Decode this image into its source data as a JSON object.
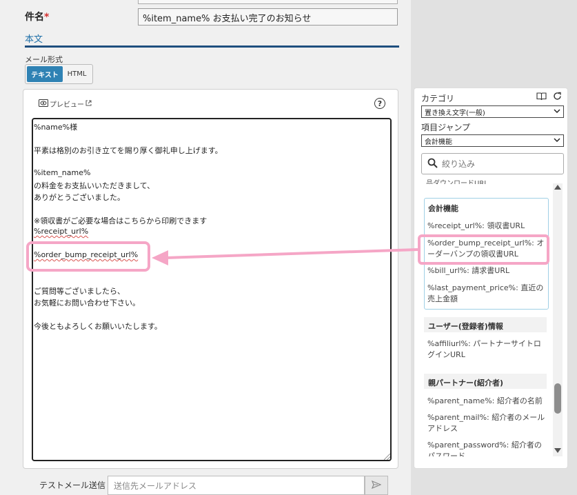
{
  "subject": {
    "label": "件名",
    "required_mark": "*",
    "value": "%item_name% お支払い完了のお知らせ"
  },
  "body_section": {
    "heading": "本文",
    "format_label": "メール形式",
    "format_options": [
      "テキスト",
      "HTML"
    ],
    "selected_format": "テキスト"
  },
  "editor": {
    "preview_label": "プレビュー",
    "lines": [
      "%name%様",
      "平素は格別のお引き立てを賜り厚く御礼申し上げます。",
      "%item_name%",
      "の料金をお支払いいただきまして、",
      "ありがとうございました。",
      "※領収書がご必要な場合はこちらから印刷できます",
      "%receipt_url%",
      "%order_bump_receipt_url%",
      "ご質問等ございましたら、",
      "お気軽にお問い合わせ下さい。",
      "今後ともよろしくお願いいたします。"
    ]
  },
  "test_mail": {
    "label": "テストメール送信",
    "placeholder": "送信先メールアドレス"
  },
  "panel": {
    "category_label": "カテゴリ",
    "category_value": "置き換え文字(一般)",
    "jump_label": "項目ジャンプ",
    "jump_value": "会計機能",
    "search_placeholder": "絞り込み",
    "cutoff_text": "品ダウンロードURL",
    "groups": [
      {
        "title": "会計機能",
        "items": [
          "%receipt_url%: 領収書URL",
          "%order_bump_receipt_url%: オーダーバンプの領収書URL",
          "%bill_url%: 請求書URL",
          "%last_payment_price%: 直近の売上金額"
        ]
      },
      {
        "title": "ユーザー(登録者)情報",
        "items": [
          "%affiliurl%: パートナーサイトログインURL"
        ]
      },
      {
        "title": "親パートナー(紹介者)",
        "items": [
          "%parent_name%: 紹介者の名前",
          "%parent_mail%: 紹介者のメールアドレス",
          "%parent_password%: 紹介者のパスワード"
        ]
      }
    ]
  },
  "colors": {
    "accent_blue": "#2f82b4",
    "highlight_pink": "#f5a6c6",
    "required_red": "#d32f2f"
  },
  "icons": [
    "eye-icon",
    "external-link-icon",
    "help-icon",
    "book-icon",
    "refresh-icon",
    "search-icon",
    "send-icon",
    "chevron-down-icon"
  ]
}
